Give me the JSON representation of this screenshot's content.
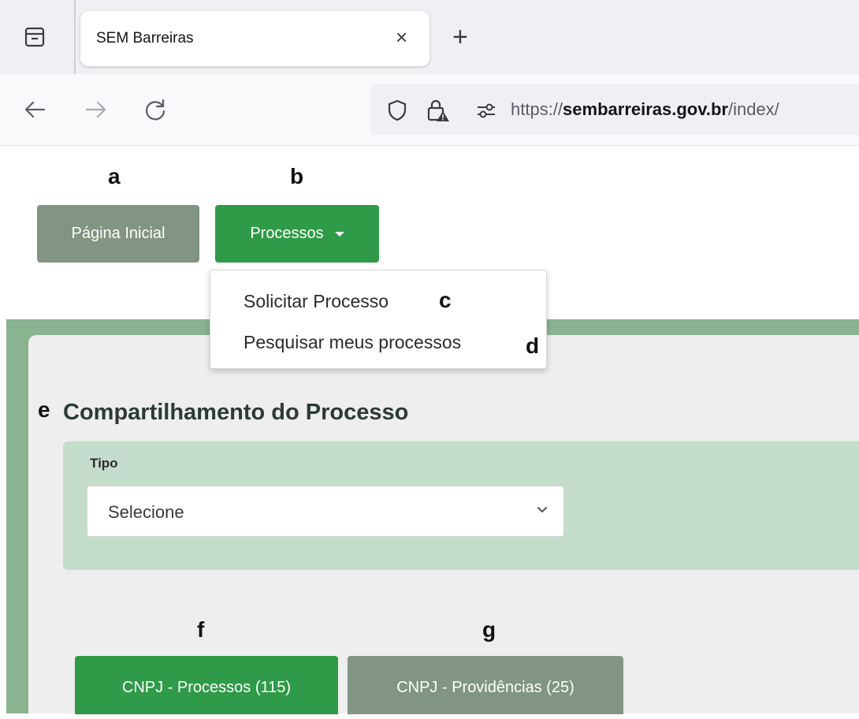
{
  "browser": {
    "tab_title": "SEM Barreiras",
    "tab_close": "×",
    "new_tab": "+",
    "url_scheme": "https://",
    "url_domain": "sembarreiras.gov.br",
    "url_path": "/index/"
  },
  "labels": {
    "a": "a",
    "b": "b",
    "c": "c",
    "d": "d",
    "e": "e",
    "f": "f",
    "g": "g"
  },
  "nav": {
    "home_label": "Página Inicial",
    "processes_label": "Processos"
  },
  "dropdown": {
    "items": [
      "Solicitar Processo",
      "Pesquisar meus processos"
    ]
  },
  "section": {
    "title": "Compartilhamento do Processo",
    "tipo_label": "Tipo",
    "select_value": "Selecione"
  },
  "tabs": {
    "processes": "CNPJ - Processos (115)",
    "providences": "CNPJ - Providências (25)"
  },
  "colors": {
    "green_button": "#2f9a48",
    "gray_button": "#829484",
    "panel_border": "#8ab38f",
    "filter_bg": "#c5ddcc"
  }
}
